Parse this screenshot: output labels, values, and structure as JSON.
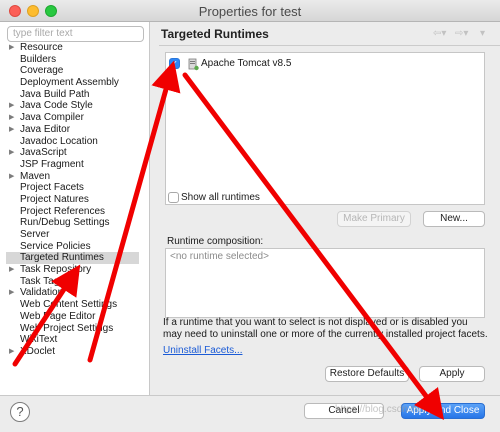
{
  "window": {
    "title": "Properties for test"
  },
  "filter": {
    "placeholder": "type filter text"
  },
  "tree": [
    {
      "label": "Resource",
      "expandable": true
    },
    {
      "label": "Builders",
      "expandable": false
    },
    {
      "label": "Coverage",
      "expandable": false
    },
    {
      "label": "Deployment Assembly",
      "expandable": false
    },
    {
      "label": "Java Build Path",
      "expandable": false
    },
    {
      "label": "Java Code Style",
      "expandable": true
    },
    {
      "label": "Java Compiler",
      "expandable": true
    },
    {
      "label": "Java Editor",
      "expandable": true
    },
    {
      "label": "Javadoc Location",
      "expandable": false
    },
    {
      "label": "JavaScript",
      "expandable": true
    },
    {
      "label": "JSP Fragment",
      "expandable": false
    },
    {
      "label": "Maven",
      "expandable": true
    },
    {
      "label": "Project Facets",
      "expandable": false
    },
    {
      "label": "Project Natures",
      "expandable": false
    },
    {
      "label": "Project References",
      "expandable": false
    },
    {
      "label": "Run/Debug Settings",
      "expandable": false
    },
    {
      "label": "Server",
      "expandable": false
    },
    {
      "label": "Service Policies",
      "expandable": false
    },
    {
      "label": "Targeted Runtimes",
      "expandable": false,
      "selected": true
    },
    {
      "label": "Task Repository",
      "expandable": true
    },
    {
      "label": "Task Tags",
      "expandable": false
    },
    {
      "label": "Validation",
      "expandable": true
    },
    {
      "label": "Web Content Settings",
      "expandable": false
    },
    {
      "label": "Web Page Editor",
      "expandable": false
    },
    {
      "label": "Web Project Settings",
      "expandable": false
    },
    {
      "label": "WikiText",
      "expandable": false
    },
    {
      "label": "XDoclet",
      "expandable": true
    }
  ],
  "page": {
    "heading": "Targeted Runtimes",
    "runtimes": [
      {
        "label": "Apache Tomcat v8.5",
        "checked": true
      }
    ],
    "show_all_label": "Show all runtimes",
    "make_primary_label": "Make Primary",
    "new_label": "New...",
    "composition_label": "Runtime composition:",
    "composition_empty": "<no runtime selected>",
    "info_text": "If a runtime that you want to select is not displayed or is disabled you may need to uninstall one or more of the currently installed project facets.",
    "uninstall_link": "Uninstall Facets...",
    "restore_label": "Restore Defaults",
    "apply_label": "Apply"
  },
  "footer": {
    "help_glyph": "?",
    "cancel_label": "Cancel",
    "apply_close_label": "Apply and Close"
  },
  "watermark": "https://blog.csdn.net/...",
  "colors": {
    "arrow": "#f00000",
    "accent": "#2f86f4",
    "link": "#1b5bd6"
  }
}
